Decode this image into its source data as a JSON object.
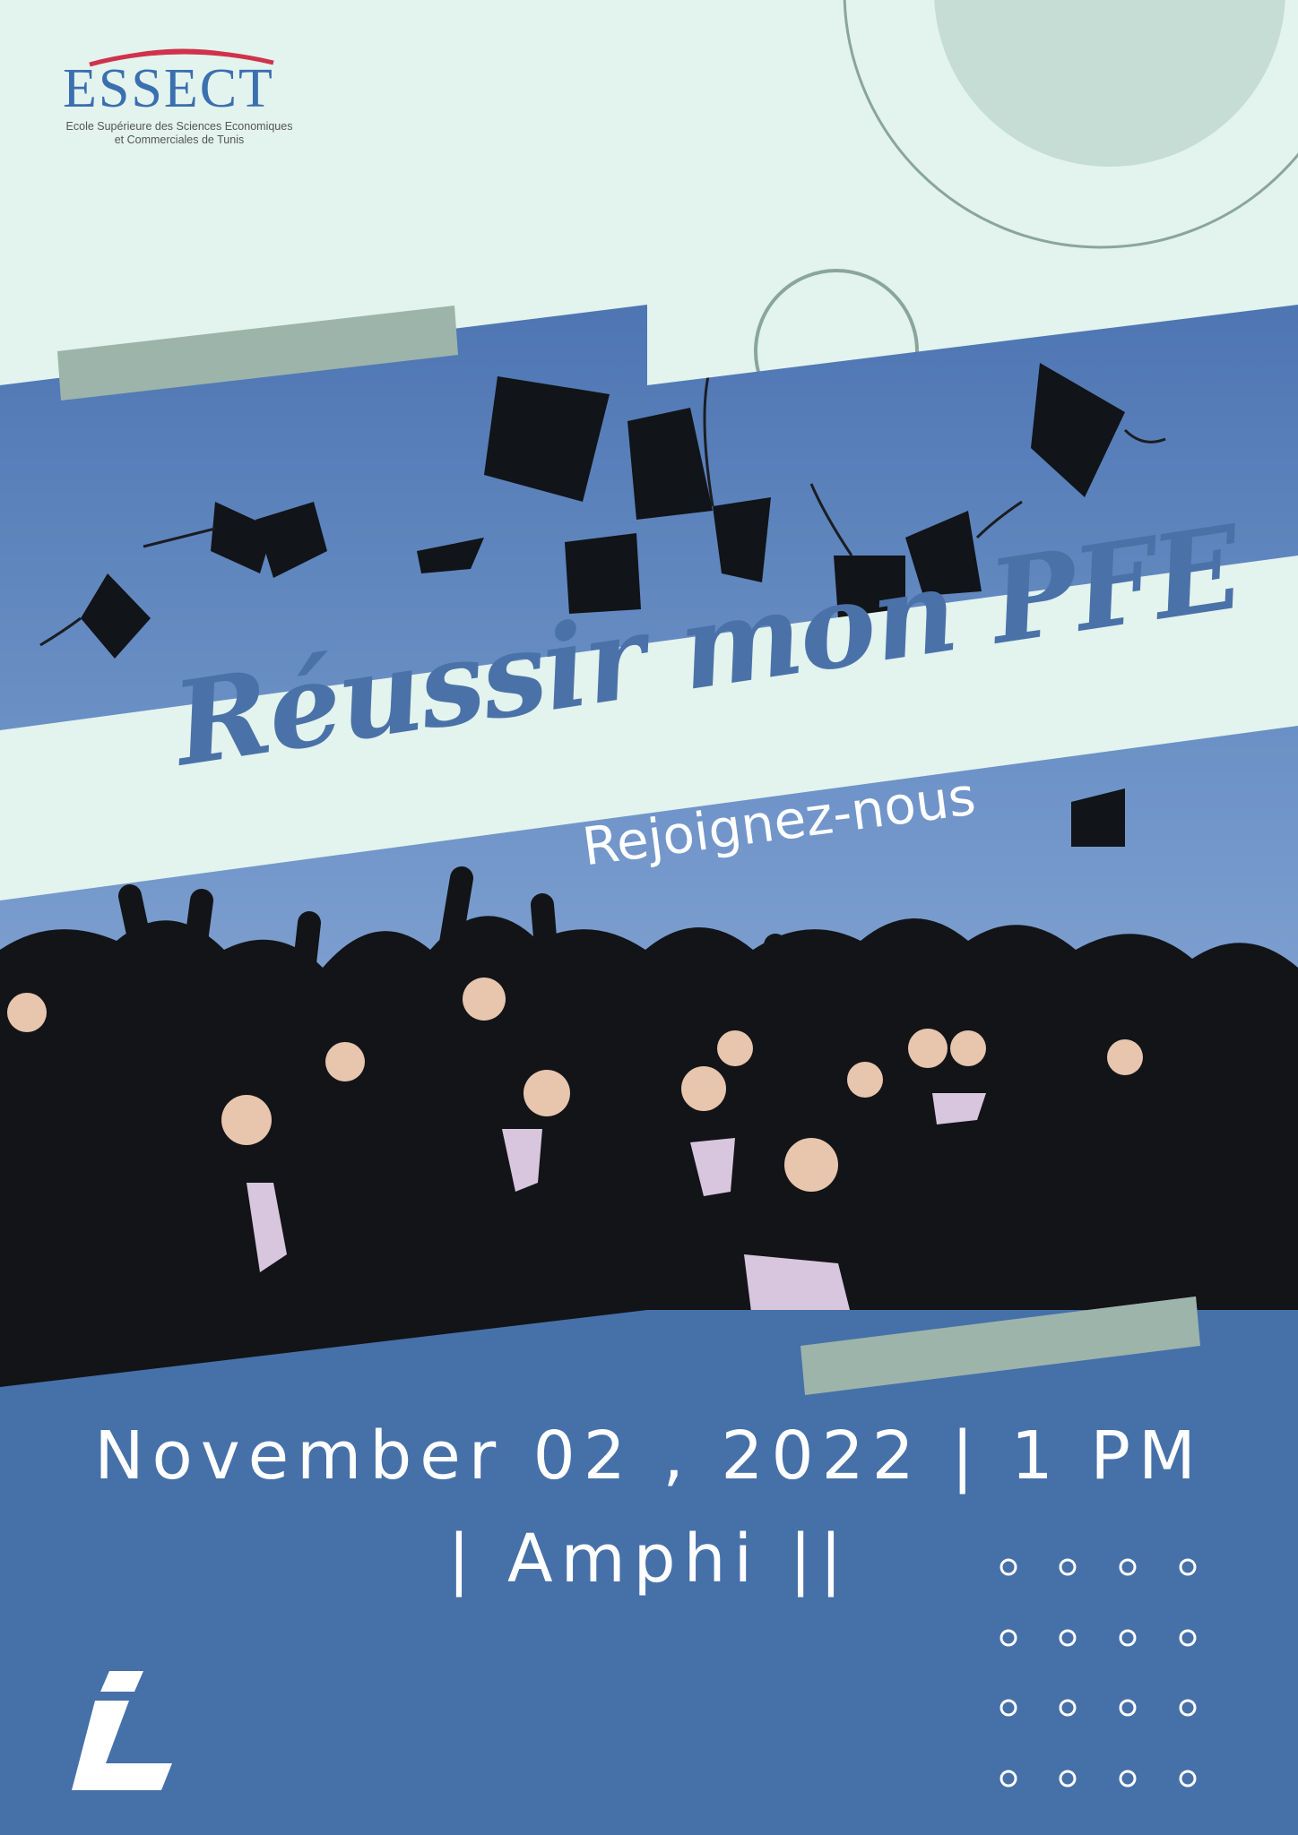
{
  "logo": {
    "name": "ESSECT",
    "subtitle_line1": "Ecole Supérieure des Sciences Economiques",
    "subtitle_line2": "et Commerciales de Tunis"
  },
  "headline": {
    "title": "Réussir mon PFE",
    "subtitle": "Rejoignez-nous"
  },
  "event": {
    "date_time": "November 02 , 2022 | 1 PM",
    "venue": "| Amphi ||"
  },
  "colors": {
    "background": "#e3f3ee",
    "navy": "#4670a8",
    "title_blue": "#4b72a8",
    "sage": "#9db4ab",
    "sky": "#5f84bd"
  },
  "icons": {
    "brand_mark": "stylized-letter-l-icon",
    "graduation_cap": "graduation-cap-icon"
  }
}
